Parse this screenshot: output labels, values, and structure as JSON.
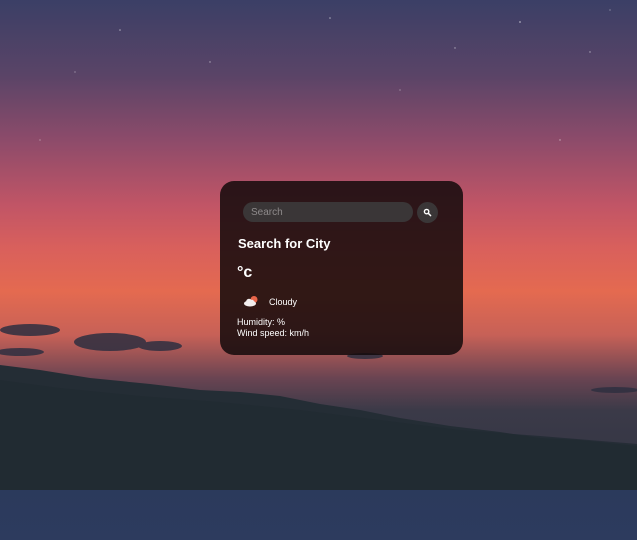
{
  "search": {
    "placeholder": "Search",
    "value": ""
  },
  "weather": {
    "city_title": "Search for City",
    "temperature": "°c",
    "condition_icon": "cloud-sun-icon",
    "condition": "Cloudy",
    "humidity": "Humidity: %",
    "wind_speed": "Wind speed: km/h"
  },
  "colors": {
    "card_background": "#140a0c",
    "input_background": "#3a3637",
    "text": "#ffffff",
    "cloud_accent": "#e8654a"
  }
}
